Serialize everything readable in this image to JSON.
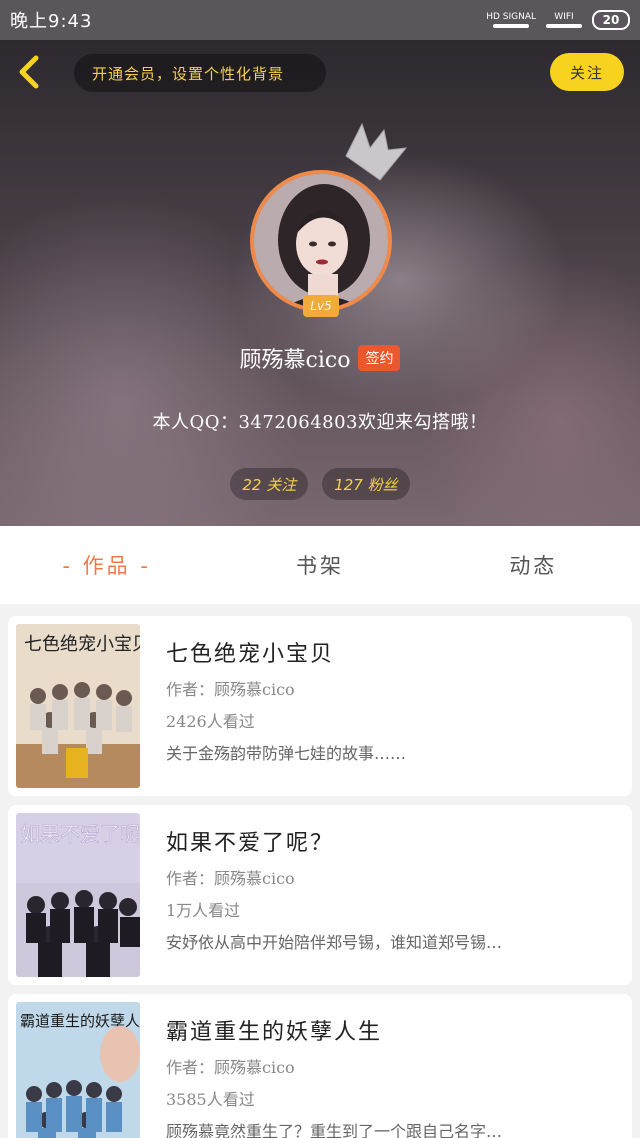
{
  "status_bar": {
    "time": "晚上9:43",
    "signal_label": "HD SIGNAL",
    "wifi_label": "WIFI",
    "battery": "20"
  },
  "header": {
    "vip_prompt": "开通会员，设置个性化背景",
    "follow_label": "关注"
  },
  "profile": {
    "level": "Lv5",
    "name": "顾殇慕cico",
    "sign_badge": "签约",
    "bio": "本人QQ：3472064803欢迎来勾搭哦！",
    "following": "22 关注",
    "fans": "127 粉丝"
  },
  "tabs": [
    {
      "label": "- 作品 -",
      "active": true
    },
    {
      "label": "书架",
      "active": false
    },
    {
      "label": "动态",
      "active": false
    }
  ],
  "works": [
    {
      "cover_text": "七色绝宠小宝贝",
      "title": "七色绝宠小宝贝",
      "author": "作者：顾殇慕cico",
      "views": "2426人看过",
      "desc": "关于金殇韵带防弹七娃的故事……"
    },
    {
      "cover_text": "如果不爱了呢？",
      "title": "如果不爱了呢？",
      "author": "作者：顾殇慕cico",
      "views": "1万人看过",
      "desc": "安妤依从高中开始陪伴郑号锡，谁知道郑号锡…"
    },
    {
      "cover_text": "霸道重生的妖孽人生",
      "title": "霸道重生的妖孽人生",
      "author": "作者：顾殇慕cico",
      "views": "3585人看过",
      "desc": "顾殇慕竟然重生了？重生到了一个跟自己名字…"
    }
  ],
  "colors": {
    "accent": "#ee7a4a",
    "gold": "#f5d247",
    "follow_button": "#f7d21e",
    "sign_badge": "#e9582f"
  }
}
